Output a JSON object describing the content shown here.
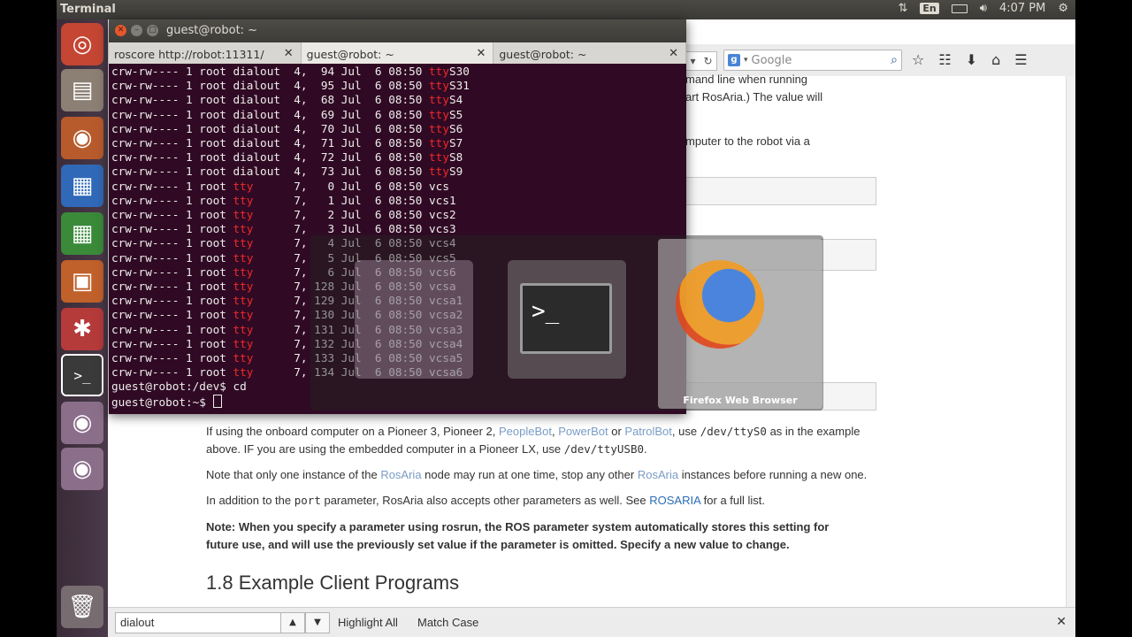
{
  "topbar": {
    "title": "Terminal",
    "lang": "En",
    "time": "4:07 PM"
  },
  "launcher": {
    "items": [
      "ubuntu-dash-icon",
      "files-icon",
      "firefox-icon",
      "writer-icon",
      "calc-icon",
      "impress-icon",
      "settings-icon",
      "terminal-icon",
      "dvd-icon",
      "dvd-icon",
      "trash-icon"
    ]
  },
  "terminal": {
    "window_title": "guest@robot: ~",
    "tabs": [
      {
        "label": "roscore http://robot:11311/"
      },
      {
        "label": "guest@robot: ~"
      },
      {
        "label": "guest@robot: ~"
      }
    ],
    "lines": [
      {
        "perm": "crw-rw---- 1 root ",
        "grp": "dialout",
        "rest": "  4,  94 Jul  6 08:50 ",
        "tty": "tty",
        "dev": "S30"
      },
      {
        "perm": "crw-rw---- 1 root ",
        "grp": "dialout",
        "rest": "  4,  95 Jul  6 08:50 ",
        "tty": "tty",
        "dev": "S31"
      },
      {
        "perm": "crw-rw---- 1 root ",
        "grp": "dialout",
        "rest": "  4,  68 Jul  6 08:50 ",
        "tty": "tty",
        "dev": "S4"
      },
      {
        "perm": "crw-rw---- 1 root ",
        "grp": "dialout",
        "rest": "  4,  69 Jul  6 08:50 ",
        "tty": "tty",
        "dev": "S5"
      },
      {
        "perm": "crw-rw---- 1 root ",
        "grp": "dialout",
        "rest": "  4,  70 Jul  6 08:50 ",
        "tty": "tty",
        "dev": "S6"
      },
      {
        "perm": "crw-rw---- 1 root ",
        "grp": "dialout",
        "rest": "  4,  71 Jul  6 08:50 ",
        "tty": "tty",
        "dev": "S7"
      },
      {
        "perm": "crw-rw---- 1 root ",
        "grp": "dialout",
        "rest": "  4,  72 Jul  6 08:50 ",
        "tty": "tty",
        "dev": "S8"
      },
      {
        "perm": "crw-rw---- 1 root ",
        "grp": "dialout",
        "rest": "  4,  73 Jul  6 08:50 ",
        "tty": "tty",
        "dev": "S9"
      },
      {
        "perm": "crw-rw---- 1 root ",
        "grp": "tty    ",
        "rest": "  7,   0 Jul  6 08:50 ",
        "tty": "",
        "dev": "vcs"
      },
      {
        "perm": "crw-rw---- 1 root ",
        "grp": "tty    ",
        "rest": "  7,   1 Jul  6 08:50 ",
        "tty": "",
        "dev": "vcs1"
      },
      {
        "perm": "crw-rw---- 1 root ",
        "grp": "tty    ",
        "rest": "  7,   2 Jul  6 08:50 ",
        "tty": "",
        "dev": "vcs2"
      },
      {
        "perm": "crw-rw---- 1 root ",
        "grp": "tty    ",
        "rest": "  7,   3 Jul  6 08:50 ",
        "tty": "",
        "dev": "vcs3"
      },
      {
        "perm": "crw-rw---- 1 root ",
        "grp": "tty    ",
        "rest": "  7,   4 Jul  6 08:50 ",
        "tty": "",
        "dev": "vcs4"
      },
      {
        "perm": "crw-rw---- 1 root ",
        "grp": "tty    ",
        "rest": "  7,   5 Jul  6 08:50 ",
        "tty": "",
        "dev": "vcs5"
      },
      {
        "perm": "crw-rw---- 1 root ",
        "grp": "tty    ",
        "rest": "  7,   6 Jul  6 08:50 ",
        "tty": "",
        "dev": "vcs6"
      },
      {
        "perm": "crw-rw---- 1 root ",
        "grp": "tty    ",
        "rest": "  7, 128 Jul  6 08:50 ",
        "tty": "",
        "dev": "vcsa"
      },
      {
        "perm": "crw-rw---- 1 root ",
        "grp": "tty    ",
        "rest": "  7, 129 Jul  6 08:50 ",
        "tty": "",
        "dev": "vcsa1"
      },
      {
        "perm": "crw-rw---- 1 root ",
        "grp": "tty    ",
        "rest": "  7, 130 Jul  6 08:50 ",
        "tty": "",
        "dev": "vcsa2"
      },
      {
        "perm": "crw-rw---- 1 root ",
        "grp": "tty    ",
        "rest": "  7, 131 Jul  6 08:50 ",
        "tty": "",
        "dev": "vcsa3"
      },
      {
        "perm": "crw-rw---- 1 root ",
        "grp": "tty    ",
        "rest": "  7, 132 Jul  6 08:50 ",
        "tty": "",
        "dev": "vcsa4"
      },
      {
        "perm": "crw-rw---- 1 root ",
        "grp": "tty    ",
        "rest": "  7, 133 Jul  6 08:50 ",
        "tty": "",
        "dev": "vcsa5"
      },
      {
        "perm": "crw-rw---- 1 root ",
        "grp": "tty    ",
        "rest": "  7, 134 Jul  6 08:50 ",
        "tty": "",
        "dev": "vcsa6"
      }
    ],
    "prompt1": "guest@robot:/dev$ cd",
    "prompt2": "guest@robot:~$ "
  },
  "switcher": {
    "firefox_label": "Firefox Web Browser"
  },
  "browser": {
    "search_placeholder": "Google",
    "search_engine_letter": "g",
    "text_right_1": "mand line when running",
    "text_right_2": "art RosAria.) The value will",
    "text_right_3": "mputer to the robot via a",
    "para1_a": "If using the onboard computer on a Pioneer 3, Pioneer 2, ",
    "para1_l1": "PeopleBot",
    "para1_s1": ", ",
    "para1_l2": "PowerBot",
    "para1_s2": " or ",
    "para1_l3": "PatrolBot",
    "para1_b": ", use ",
    "para1_code1": "/dev/ttyS0",
    "para1_c": " as in the example",
    "para1_line2_a": "above. IF you are using the embedded computer in a Pioneer LX, use ",
    "para1_code2": "/dev/ttyUSB0",
    "para1_line2_b": ".",
    "para2_a": "Note that only one instance of the ",
    "para2_l1": "RosAria",
    "para2_b": " node may run at one time, stop any other ",
    "para2_l2": "RosAria",
    "para2_c": " instances before running a new one.",
    "para3_a": "In addition to the ",
    "para3_code": "port",
    "para3_b": " parameter, RosAria also accepts other parameters as well. See ",
    "para3_link": "ROSARIA",
    "para3_c": " for a full list.",
    "para4_line1": "Note: When you specify a parameter using rosrun, the ROS parameter system automatically stores this setting for",
    "para4_line2": "future use, and will use the previously set value if the parameter is omitted. Specify a new value to change.",
    "heading": "1.8 Example Client Programs"
  },
  "findbar": {
    "query": "dialout",
    "highlight_all": "Highlight All",
    "match_case": "Match Case"
  }
}
